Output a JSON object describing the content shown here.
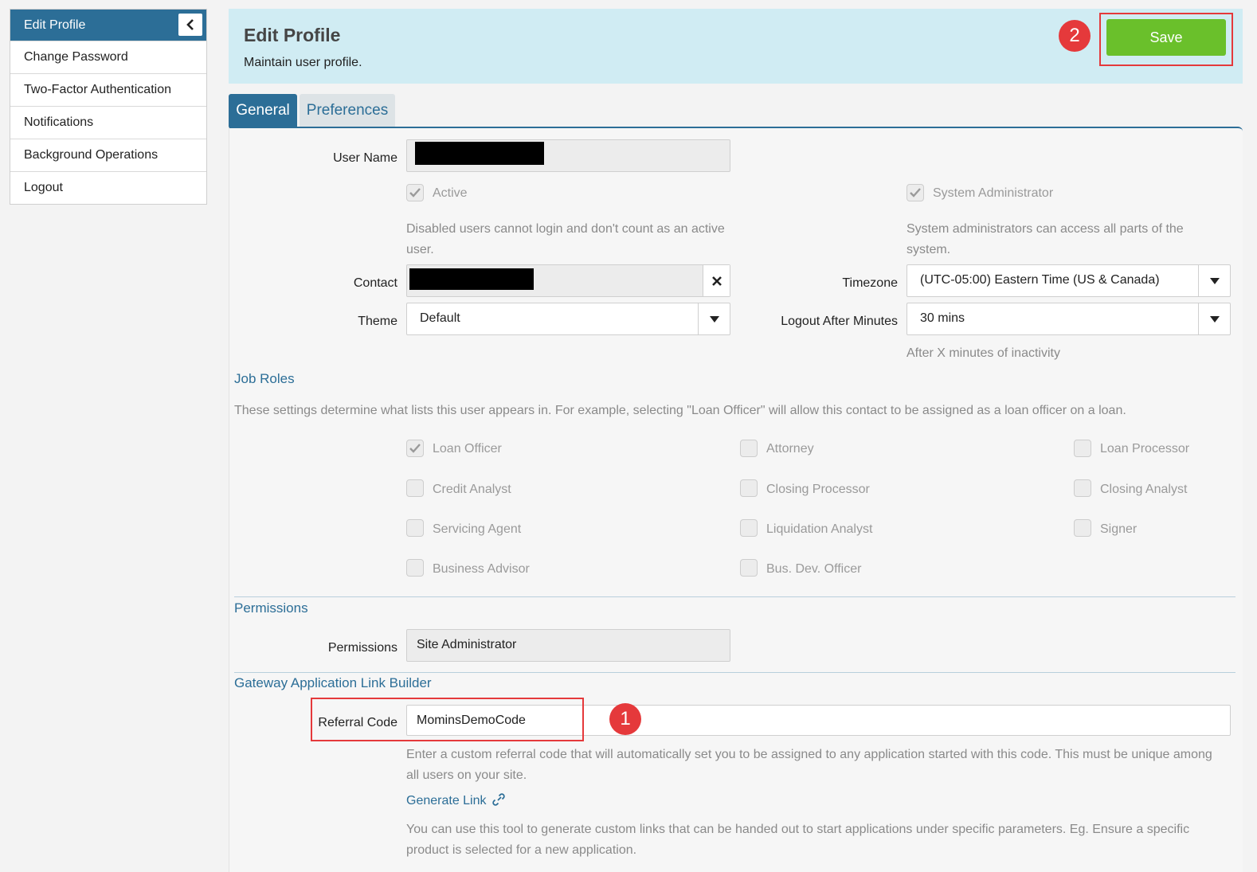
{
  "sidebar": {
    "items": [
      {
        "label": "Edit Profile"
      },
      {
        "label": "Change Password"
      },
      {
        "label": "Two-Factor Authentication"
      },
      {
        "label": "Notifications"
      },
      {
        "label": "Background Operations"
      },
      {
        "label": "Logout"
      }
    ]
  },
  "header": {
    "title": "Edit Profile",
    "subtitle": "Maintain user profile.",
    "save_label": "Save"
  },
  "annotations": {
    "badge1": "1",
    "badge2": "2"
  },
  "tabs": [
    {
      "label": "General"
    },
    {
      "label": "Preferences"
    }
  ],
  "form": {
    "user_name_label": "User Name",
    "active_label": "Active",
    "active_help": "Disabled users cannot login and don't count as an active user.",
    "sysadmin_label": "System Administrator",
    "sysadmin_help": "System administrators can access all parts of the system.",
    "contact_label": "Contact",
    "timezone_label": "Timezone",
    "timezone_value": "(UTC-05:00) Eastern Time (US & Canada)",
    "theme_label": "Theme",
    "theme_value": "Default",
    "logout_label": "Logout After Minutes",
    "logout_value": "30 mins",
    "logout_help": "After X minutes of inactivity"
  },
  "job_roles": {
    "title": "Job Roles",
    "help": "These settings determine what lists this user appears in. For example, selecting \"Loan Officer\" will allow this contact to be assigned as a loan officer on a loan.",
    "roles": [
      {
        "label": "Loan Officer",
        "checked": true
      },
      {
        "label": "Attorney",
        "checked": false
      },
      {
        "label": "Loan Processor",
        "checked": false
      },
      {
        "label": "Credit Analyst",
        "checked": false
      },
      {
        "label": "Closing Processor",
        "checked": false
      },
      {
        "label": "Closing Analyst",
        "checked": false
      },
      {
        "label": "Servicing Agent",
        "checked": false
      },
      {
        "label": "Liquidation Analyst",
        "checked": false
      },
      {
        "label": "Signer",
        "checked": false
      },
      {
        "label": "Business Advisor",
        "checked": false
      },
      {
        "label": "Bus. Dev. Officer",
        "checked": false
      }
    ]
  },
  "permissions": {
    "title": "Permissions",
    "label": "Permissions",
    "value": "Site Administrator"
  },
  "gateway": {
    "title": "Gateway Application Link Builder",
    "referral_label": "Referral Code",
    "referral_value": "MominsDemoCode",
    "referral_help": "Enter a custom referral code that will automatically set you to be assigned to any application started with this code. This must be unique among all users on your site.",
    "generate_link": "Generate Link",
    "link_help": "You can use this tool to generate custom links that can be handed out to start applications under specific parameters. Eg. Ensure a specific product is selected for a new application."
  }
}
